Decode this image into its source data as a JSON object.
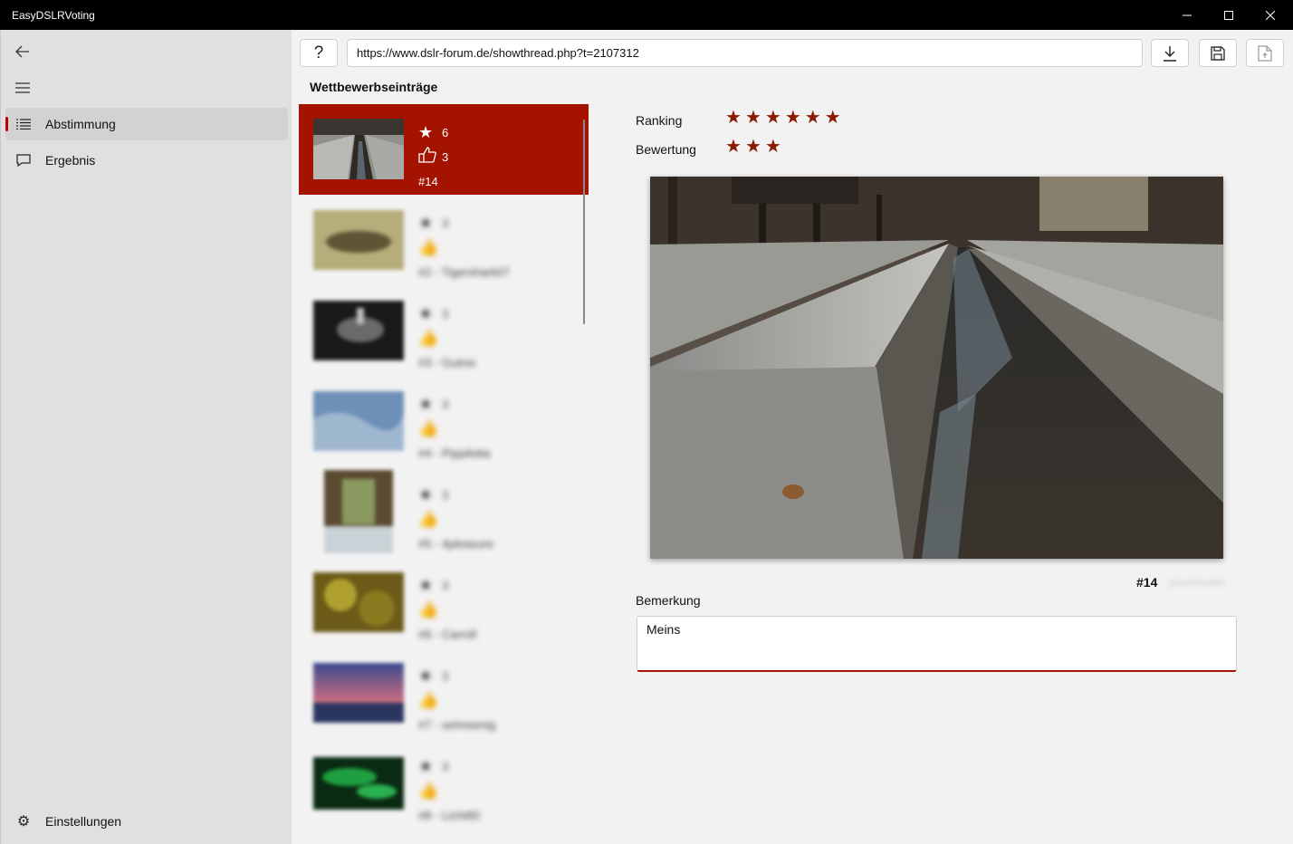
{
  "window": {
    "title": "EasyDSLRVoting"
  },
  "nav": {
    "items": [
      {
        "label": "Abstimmung",
        "icon": "list-icon"
      },
      {
        "label": "Ergebnis",
        "icon": "comment-icon"
      }
    ],
    "settings_label": "Einstellungen"
  },
  "toolbar": {
    "url": "https://www.dslr-forum.de/showthread.php?t=2107312"
  },
  "entries": {
    "title": "Wettbewerbseinträge",
    "items": [
      {
        "ranking": "6",
        "likes": "3",
        "label": "#14"
      },
      {
        "ranking": "3",
        "likes": "",
        "label": "#2 - Tigershark07"
      },
      {
        "ranking": "3",
        "likes": "",
        "label": "#3 - Gutnix"
      },
      {
        "ranking": "3",
        "likes": "",
        "label": "#4 - Pippilotta"
      },
      {
        "ranking": "3",
        "likes": "",
        "label": "#5 - 4pleasure"
      },
      {
        "ranking": "3",
        "likes": "",
        "label": "#6 - Carroll"
      },
      {
        "ranking": "3",
        "likes": "",
        "label": "#7 - sehrwenig"
      },
      {
        "ranking": "3",
        "likes": "",
        "label": "#8 - Licht80"
      }
    ]
  },
  "detail": {
    "ranking_label": "Ranking",
    "ranking_value": 6,
    "rating_label": "Bewertung",
    "rating_value": 3,
    "image_number": "#14",
    "image_author": "pixelmaster",
    "remark_label": "Bemerkung",
    "remark_value": "Meins"
  },
  "colors": {
    "accent": "#a31300",
    "star": "#8b1a00"
  }
}
